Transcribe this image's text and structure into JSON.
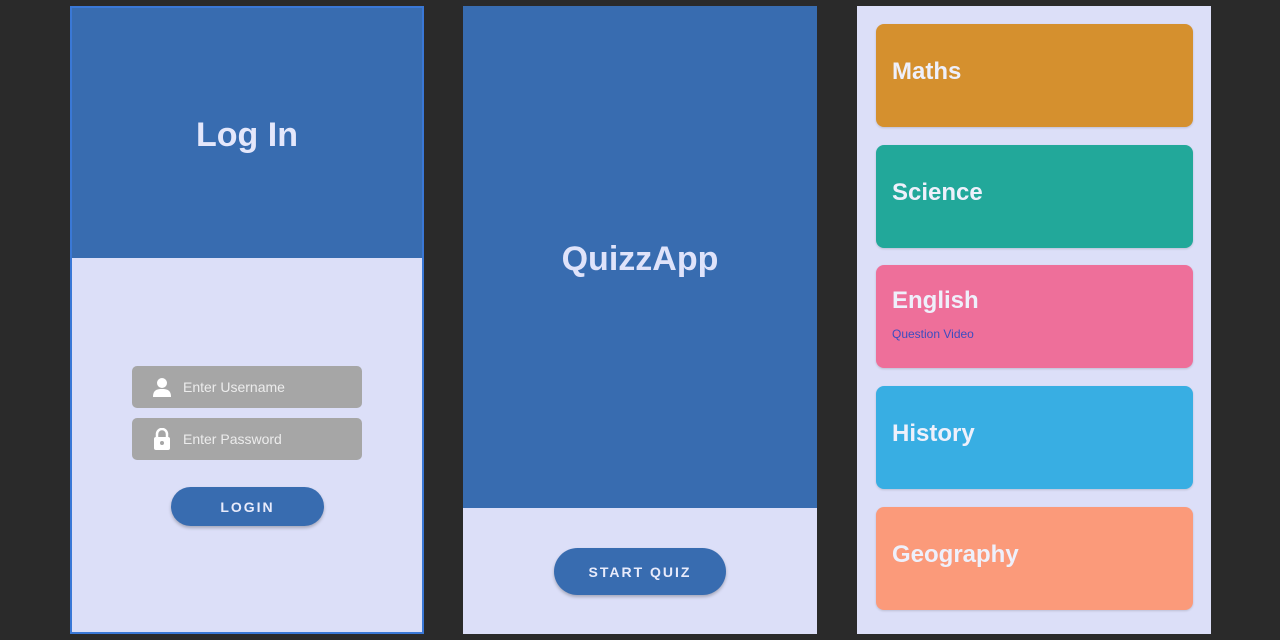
{
  "login": {
    "title": "Log In",
    "username_placeholder": "Enter Username",
    "password_placeholder": "Enter Password",
    "login_label": "LOGIN"
  },
  "splash": {
    "app_name": "QuizzApp",
    "start_label": "START QUIZ"
  },
  "categories": {
    "items": [
      {
        "label": "Maths",
        "color": "#d5902e"
      },
      {
        "label": "Science",
        "color": "#22a89a"
      },
      {
        "label": "English",
        "subtitle": "Question Video",
        "color": "#ee6f9a"
      },
      {
        "label": "History",
        "color": "#38aee3"
      },
      {
        "label": "Geography",
        "color": "#fb9a7a"
      }
    ]
  },
  "colors": {
    "primary": "#386cb0",
    "background": "#dcdff8",
    "input": "#a6a6a6",
    "canvas": "#2a2a2a"
  },
  "icons": {
    "username": "person-icon",
    "password": "lock-icon"
  }
}
